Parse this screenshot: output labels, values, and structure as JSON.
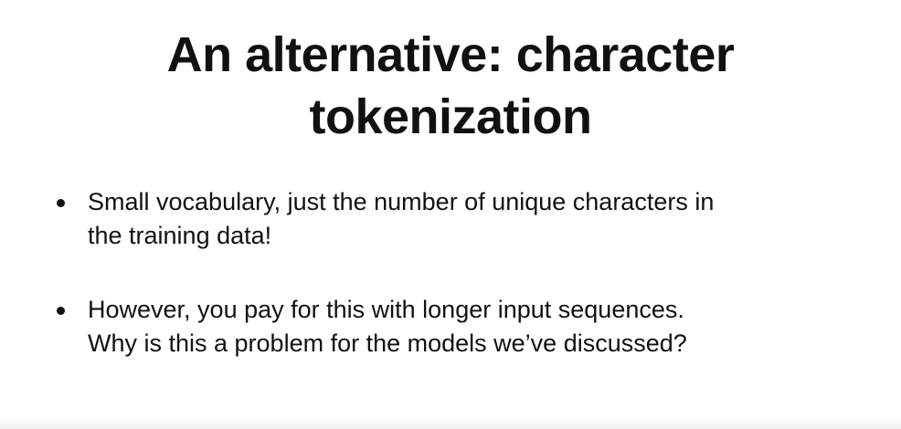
{
  "slide": {
    "title_lines": [
      "An alternative: character",
      "tokenization"
    ],
    "bullets": [
      {
        "lines": [
          "Small vocabulary, just the number of unique characters in",
          "the training data!"
        ]
      },
      {
        "lines": [
          "However, you pay for this with longer input sequences.",
          "Why is this a problem for the models we’ve discussed?"
        ]
      }
    ]
  }
}
